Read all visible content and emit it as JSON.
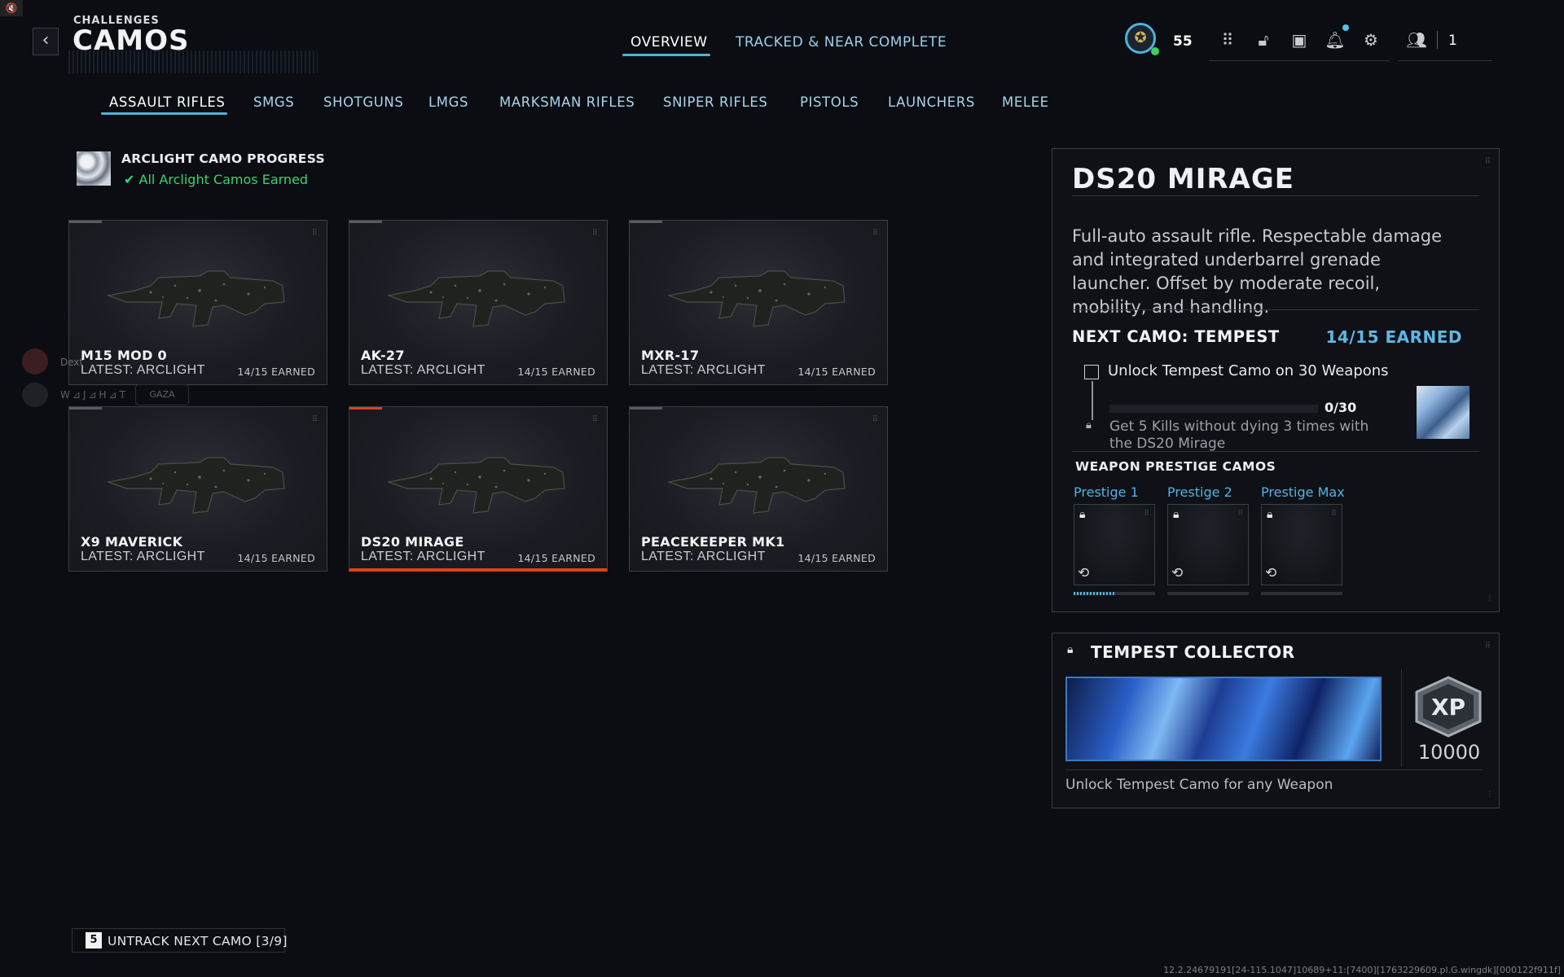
{
  "header": {
    "system_icon": "🔇",
    "back_icon": "‹",
    "breadcrumb_small": "CHALLENGES",
    "breadcrumb_title": "CAMOS",
    "tabs": [
      {
        "label": "OVERVIEW",
        "active": true
      },
      {
        "label": "TRACKED & NEAR COMPLETE",
        "active": false
      }
    ],
    "player_level": "55",
    "party_count": "1",
    "icons": [
      "grid-icon",
      "unlock-icon",
      "camera-icon",
      "bell-icon",
      "gear-icon",
      "friends-icon"
    ]
  },
  "categories": [
    {
      "label": "ASSAULT RIFLES",
      "active": true
    },
    {
      "label": "SMGS"
    },
    {
      "label": "SHOTGUNS"
    },
    {
      "label": "LMGS"
    },
    {
      "label": "MARKSMAN RIFLES"
    },
    {
      "label": "SNIPER RIFLES"
    },
    {
      "label": "PISTOLS"
    },
    {
      "label": "LAUNCHERS"
    },
    {
      "label": "MELEE"
    }
  ],
  "progress": {
    "title": "ARCLIGHT CAMO PROGRESS",
    "status": "All Arclight Camos Earned",
    "status_color": "#39d46b"
  },
  "weapons": [
    {
      "name": "M15 MOD 0",
      "latest": "LATEST: ARCLIGHT",
      "earned": "14/15 EARNED"
    },
    {
      "name": "AK-27",
      "latest": "LATEST: ARCLIGHT",
      "earned": "14/15 EARNED"
    },
    {
      "name": "MXR-17",
      "latest": "LATEST: ARCLIGHT",
      "earned": "14/15 EARNED"
    },
    {
      "name": "X9 MAVERICK",
      "latest": "LATEST: ARCLIGHT",
      "earned": "14/15 EARNED"
    },
    {
      "name": "DS20 MIRAGE",
      "latest": "LATEST: ARCLIGHT",
      "earned": "14/15 EARNED",
      "selected": true
    },
    {
      "name": "PEACEKEEPER MK1",
      "latest": "LATEST: ARCLIGHT",
      "earned": "14/15 EARNED"
    }
  ],
  "overlay": {
    "name": "Dext",
    "tag": "W⊿J⊿H⊿T",
    "pill": "GAZA"
  },
  "detail": {
    "title": "DS20 MIRAGE",
    "description": "Full-auto assault rifle. Respectable damage and integrated underbarrel grenade launcher. Offset by moderate recoil, mobility, and handling.",
    "next_camo": "NEXT CAMO: TEMPEST",
    "next_earned": "14/15 EARNED",
    "challenge_label": "Unlock Tempest Camo on 30 Weapons",
    "challenge_progress": "0/30",
    "challenge_progress_fraction": 0,
    "requirement": "Get 5 Kills without dying 3 times with the DS20 Mirage",
    "prestige_heading": "WEAPON PRESTIGE CAMOS",
    "prestige": [
      {
        "label": "Prestige 1",
        "progress_fraction": 0.5
      },
      {
        "label": "Prestige 2",
        "progress_fraction": 0
      },
      {
        "label": "Prestige Max",
        "progress_fraction": 0
      }
    ]
  },
  "collector": {
    "title": "TEMPEST COLLECTOR",
    "xp_label": "XP",
    "xp_amount": "10000",
    "description": "Unlock Tempest Camo for any Weapon"
  },
  "footer": {
    "key": "5",
    "untrack_label": "UNTRACK NEXT CAMO [3/9]",
    "build": "12.2.24679191[24-115.1047]10689+11:[7400][1763229609.pl.G.wingdk][000122f911f]"
  },
  "colors": {
    "accent": "#4fb3d9",
    "selected": "#e0401e"
  }
}
